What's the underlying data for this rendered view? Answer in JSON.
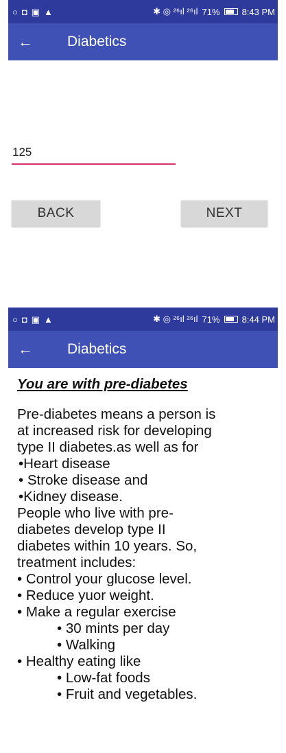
{
  "screen1": {
    "status": {
      "left_icons": [
        "○",
        "◘",
        "▣",
        "▲"
      ],
      "right_icons": "✱ ◎ ²⁶ıl ²⁶ıl",
      "battery": "71%",
      "time": "8:43 PM"
    },
    "appbar": {
      "back_icon": "←",
      "title": "Diabetics"
    },
    "input": {
      "value": "125"
    },
    "buttons": {
      "back": "BACK",
      "next": "NEXT"
    }
  },
  "screen2": {
    "status": {
      "left_icons": [
        "○",
        "◘",
        "▣",
        "▲"
      ],
      "right_icons": "✱ ◎ ²⁶ıl ²⁶ıl",
      "battery": "71%",
      "time": "8:44 PM"
    },
    "appbar": {
      "back_icon": "←",
      "title": "Diabetics"
    },
    "heading": "You are with pre-diabetes",
    "lines": [
      "Pre-diabetes means a person is",
      "at increased risk for developing",
      "type II diabetes.as well as for",
      " •Heart disease",
      " • Stroke disease and",
      " •Kidney disease.",
      " People who live with pre-",
      "diabetes develop type II",
      "diabetes within 10 years. So,",
      "treatment includes:",
      "•  Control your glucose level.",
      "•  Reduce yuor weight.",
      "•  Make a regular exercise"
    ],
    "sub1": [
      "•   30 mints per day",
      "•   Walking"
    ],
    "line_after": "• Healthy eating like",
    "sub2": [
      "•   Low-fat foods",
      "•   Fruit and vegetables."
    ]
  }
}
